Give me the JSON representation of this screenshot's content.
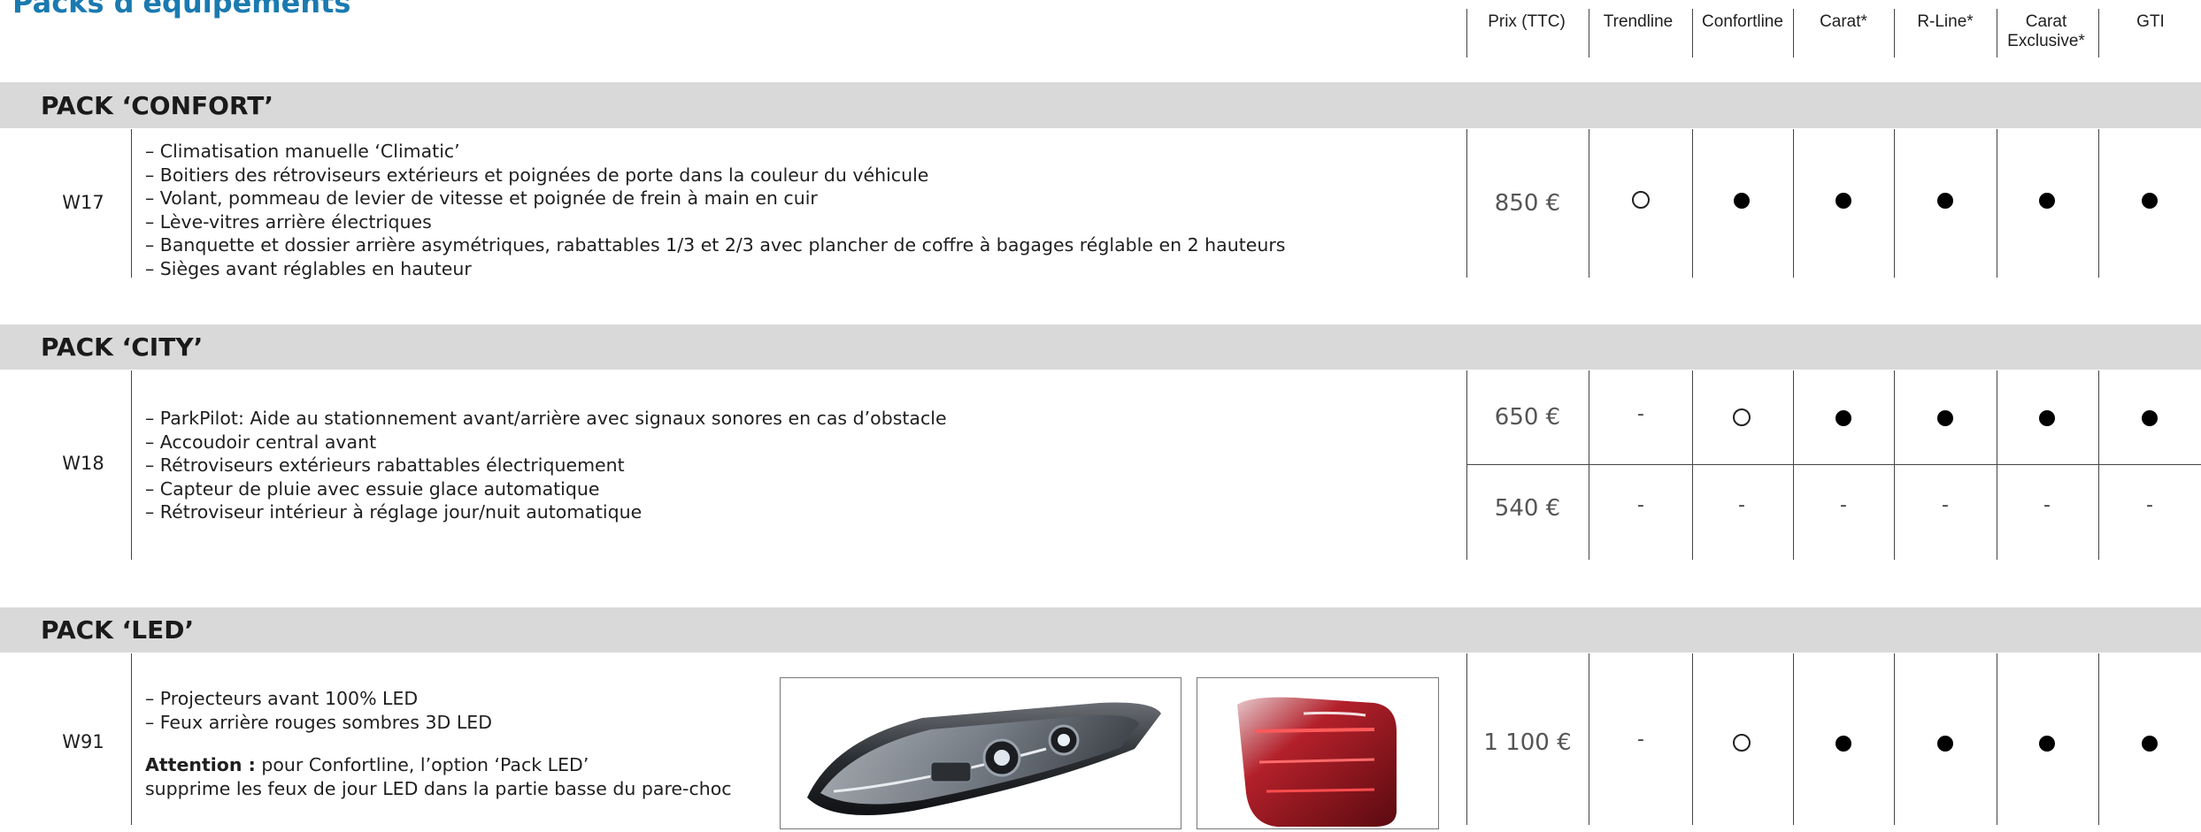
{
  "page_title": "Packs d'équipements",
  "columns": [
    "Prix (TTC)",
    "Trendline",
    "Confortline",
    "Carat*",
    "R-Line*",
    "Carat Exclusive*",
    "GTI"
  ],
  "packs": [
    {
      "name": "PACK ‘CONFORT’",
      "code": "W17",
      "lines": [
        "– Climatisation manuelle ‘Climatic’",
        "– Boitiers des rétroviseurs extérieurs et poignées de porte dans la couleur du véhicule",
        "– Volant, pommeau de levier de vitesse et poignée de frein à main en cuir",
        "– Lève-vitres arrière électriques",
        "– Banquette et dossier arrière asymétriques, rabattables 1/3 et 2/3 avec plancher de coffre à bagages réglable en 2 hauteurs",
        "– Sièges avant réglables en hauteur"
      ],
      "rows": [
        {
          "price": "850 €",
          "marks": [
            "optional",
            "standard",
            "standard",
            "standard",
            "standard",
            "standard"
          ]
        }
      ]
    },
    {
      "name": "PACK ‘CITY’",
      "code": "W18",
      "lines": [
        "– ParkPilot: Aide au stationnement avant/arrière avec signaux sonores en cas d’obstacle",
        "– Accoudoir central avant",
        "– Rétroviseurs extérieurs rabattables électriquement",
        "– Capteur de pluie avec essuie glace automatique",
        "– Rétroviseur intérieur à réglage jour/nuit automatique"
      ],
      "rows": [
        {
          "price": "650 €",
          "marks": [
            "na",
            "optional",
            "standard",
            "standard",
            "standard",
            "standard"
          ]
        },
        {
          "price": "540 €",
          "marks": [
            "na",
            "na",
            "na",
            "na",
            "na",
            "na"
          ]
        }
      ]
    },
    {
      "name": "PACK ‘LED’",
      "code": "W91",
      "lines": [
        "– Projecteurs avant 100% LED",
        "– Feux arrière rouges sombres 3D LED"
      ],
      "attention_label": "Attention :",
      "attention_text_1": " pour Confortline, l’option ‘Pack LED’",
      "attention_text_2": "supprime les feux de jour LED dans la partie basse du pare-choc",
      "images": [
        "headlight-image",
        "taillight-image"
      ],
      "rows": [
        {
          "price": "1 100 €",
          "marks": [
            "na",
            "optional",
            "standard",
            "standard",
            "standard",
            "standard"
          ]
        }
      ]
    }
  ],
  "mark_symbols": {
    "standard": "●",
    "optional": "○",
    "na": "-"
  }
}
